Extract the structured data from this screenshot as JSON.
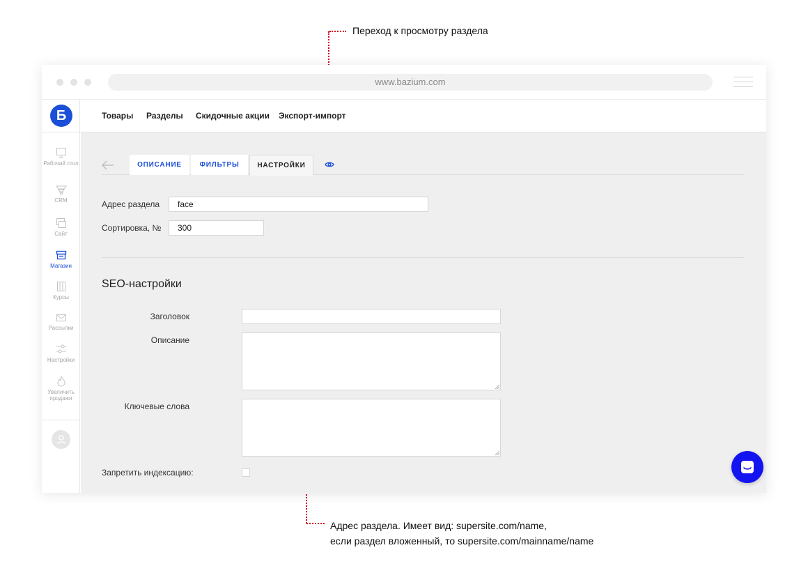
{
  "annotations": {
    "top": "Переход к просмотру раздела",
    "bottom_line1": "Адрес раздела. Имеет вид: supersite.com/name,",
    "bottom_line2": "если раздел вложенный, то supersite.com/mainname/name"
  },
  "browser": {
    "url": "www.bazium.com"
  },
  "logo": {
    "letter": "Б",
    "color": "#1b4fd8"
  },
  "sidebar": {
    "items": [
      {
        "label": "Рабочий стол",
        "icon": "monitor-icon",
        "active": false
      },
      {
        "label": "CRM",
        "icon": "funnel-icon",
        "active": false
      },
      {
        "label": "Сайт",
        "icon": "site-icon",
        "active": false
      },
      {
        "label": "Магазин",
        "icon": "shop-icon",
        "active": true
      },
      {
        "label": "Курсы",
        "icon": "courses-icon",
        "active": false
      },
      {
        "label": "Рассылки",
        "icon": "envelope-icon",
        "active": false
      },
      {
        "label": "Настройки",
        "icon": "sliders-icon",
        "active": false
      },
      {
        "label": "Увеличить продажи",
        "icon": "flame-icon",
        "active": false
      }
    ]
  },
  "topnav": {
    "items": [
      "Товары",
      "Разделы",
      "Скидочные акции",
      "Экспорт-импорт"
    ]
  },
  "tabs": [
    {
      "label": "ОПИСАНИЕ",
      "active": false
    },
    {
      "label": "ФИЛЬТРЫ",
      "active": false
    },
    {
      "label": "НАСТРОЙКИ",
      "active": true
    }
  ],
  "form": {
    "address_label": "Адрес раздела",
    "address_value": "face",
    "sort_label": "Сортировка, №",
    "sort_value": "300"
  },
  "seo": {
    "title": "SEO-настройки",
    "heading_label": "Заголовок",
    "heading_value": "",
    "description_label": "Описание",
    "keywords_label": "Ключевые слова",
    "noindex_label": "Запретить индексацию:",
    "noindex_checked": false
  },
  "colors": {
    "accent": "#1b4fd8",
    "annotation": "#d0021b",
    "chat": "#1414f0"
  }
}
